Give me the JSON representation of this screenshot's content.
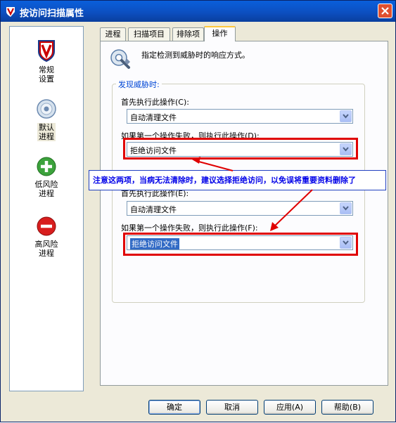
{
  "window": {
    "title": "按访问扫描属性"
  },
  "sidebar": {
    "items": [
      {
        "label_line1": "常规",
        "label_line2": "设置",
        "icon": "shield-v-icon"
      },
      {
        "label_line1": "默认",
        "label_line2": "进程",
        "icon": "disc-icon"
      },
      {
        "label_line1": "低风险",
        "label_line2": "进程",
        "icon": "green-plus-icon"
      },
      {
        "label_line1": "高风险",
        "label_line2": "进程",
        "icon": "red-minus-icon"
      }
    ]
  },
  "tabs": [
    {
      "label": "进程"
    },
    {
      "label": "扫描项目"
    },
    {
      "label": "排除项"
    },
    {
      "label": "操作"
    }
  ],
  "panel": {
    "header_text": "指定检测到威胁时的响应方式。",
    "group_title": "发现威胁时:",
    "first_label": "首先执行此操作(C):",
    "first_value": "自动清理文件",
    "fallback_label": "如果第一个操作失败，则执行此操作(D):",
    "fallback_value": "拒绝访问文件",
    "second_first_label": "首先执行此操作(E):",
    "second_first_value": "自动清理文件",
    "second_fallback_label": "如果第一个操作失败，则执行此操作(F):",
    "second_fallback_value": "拒绝访问文件"
  },
  "annotation": {
    "text": "注意这两项，当病无法清除时，建议选择拒绝访问，以免误将重要资料删除了",
    "color": "#0000E8",
    "box_color": "#E00000"
  },
  "buttons": {
    "ok": "确定",
    "cancel": "取消",
    "apply": "应用(A)",
    "help": "帮助(B)"
  }
}
